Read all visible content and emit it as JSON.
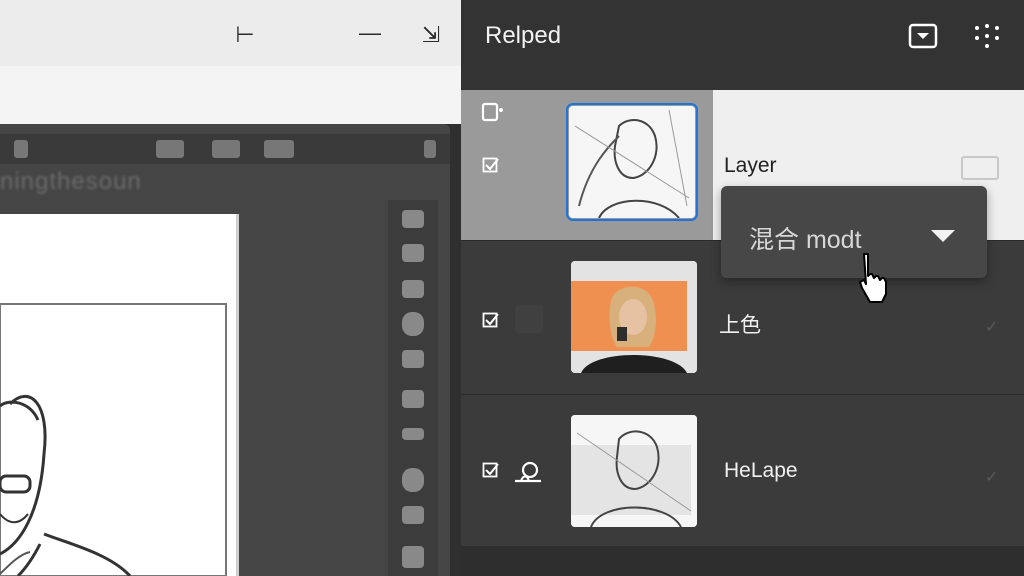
{
  "app": {
    "window_controls": {
      "back": "⊢",
      "minimize": "—",
      "expand": "⇲"
    },
    "faded_title": "ningthesoun",
    "canvas_figure_icon": "sketch-portrait"
  },
  "layers_panel": {
    "title": "Relped",
    "header_icons": [
      "dropdown-box-icon",
      "grid-dots-icon"
    ],
    "layers": [
      {
        "name": "Layer",
        "selected": true,
        "visible": true,
        "thumbnail": "pencil-sketch-portrait"
      },
      {
        "name": "上色",
        "selected": false,
        "visible": true,
        "thumbnail": "colored-portrait"
      },
      {
        "name": "HeLape",
        "selected": false,
        "visible": true,
        "thumbnail": "pencil-sketch-portrait"
      }
    ],
    "blend_mode_dropdown": {
      "label": "混合 modt"
    },
    "colors": {
      "panel_bg": "#3a3a3a",
      "selected_row": "#efefef",
      "dropdown_bg": "#474747",
      "selection_outline": "#1f74d9",
      "accent_orange": "#f09050"
    }
  }
}
